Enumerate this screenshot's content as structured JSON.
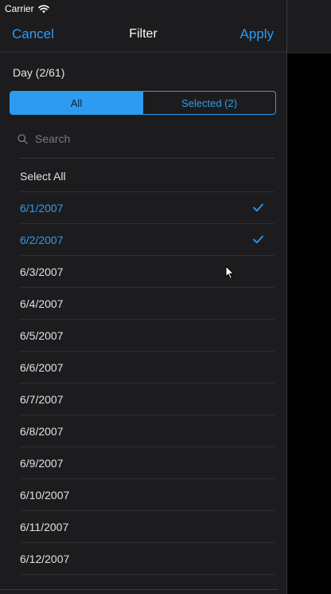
{
  "status_bar": {
    "carrier": "Carrier",
    "wifi_icon": "wifi-icon"
  },
  "nav": {
    "cancel_label": "Cancel",
    "title": "Filter",
    "apply_label": "Apply"
  },
  "section": {
    "header": "Day (2/61)"
  },
  "segments": {
    "all_label": "All",
    "selected_label": "Selected (2)",
    "active": "all"
  },
  "search": {
    "placeholder": "Search",
    "value": ""
  },
  "list": {
    "select_all_label": "Select All",
    "items": [
      {
        "label": "6/1/2007",
        "selected": true
      },
      {
        "label": "6/2/2007",
        "selected": true
      },
      {
        "label": "6/3/2007",
        "selected": false
      },
      {
        "label": "6/4/2007",
        "selected": false
      },
      {
        "label": "6/5/2007",
        "selected": false
      },
      {
        "label": "6/6/2007",
        "selected": false
      },
      {
        "label": "6/7/2007",
        "selected": false
      },
      {
        "label": "6/8/2007",
        "selected": false
      },
      {
        "label": "6/9/2007",
        "selected": false
      },
      {
        "label": "6/10/2007",
        "selected": false
      },
      {
        "label": "6/11/2007",
        "selected": false
      },
      {
        "label": "6/12/2007",
        "selected": false
      }
    ]
  },
  "colors": {
    "accent": "#2d9cf0",
    "panel_background": "#1c1c1e",
    "text_primary": "#e0e0e2",
    "text_placeholder": "#7c7c80",
    "divider": "#2f2f31"
  },
  "icons": {
    "search": "search-icon",
    "check": "checkmark-icon",
    "cursor": "mouse-cursor-icon"
  }
}
